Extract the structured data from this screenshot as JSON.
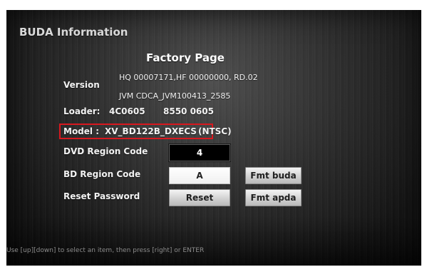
{
  "header": {
    "app_title": "BUDA Information",
    "page_title": "Factory Page"
  },
  "info": {
    "version_label": "Version",
    "version_line1": "HQ 00007171,HF 00000000, RD.02",
    "version_line2": "JVM CDCA_JVM100413_2585",
    "loader_label": "Loader:",
    "loader_value1": "4C0605",
    "loader_value2": "8550 0605",
    "model_label": "Model :",
    "model_value": "XV_BD122B_DXECS",
    "model_suffix": "(NTSC)"
  },
  "settings": {
    "dvd_region_label": "DVD Region Code",
    "dvd_region_value": "4",
    "bd_region_label": "BD Region Code",
    "bd_region_value": "A",
    "reset_password_label": "Reset Password",
    "reset_button": "Reset",
    "fmt_buda_button": "Fmt buda",
    "fmt_apda_button": "Fmt apda"
  },
  "footer": {
    "help_text": "Use [up][down] to select an item, then press [right] or ENTER"
  },
  "colors": {
    "highlight_border": "#d8181f",
    "selected_field_bg": "#000000",
    "screen_bg": "#2c2c2c"
  }
}
